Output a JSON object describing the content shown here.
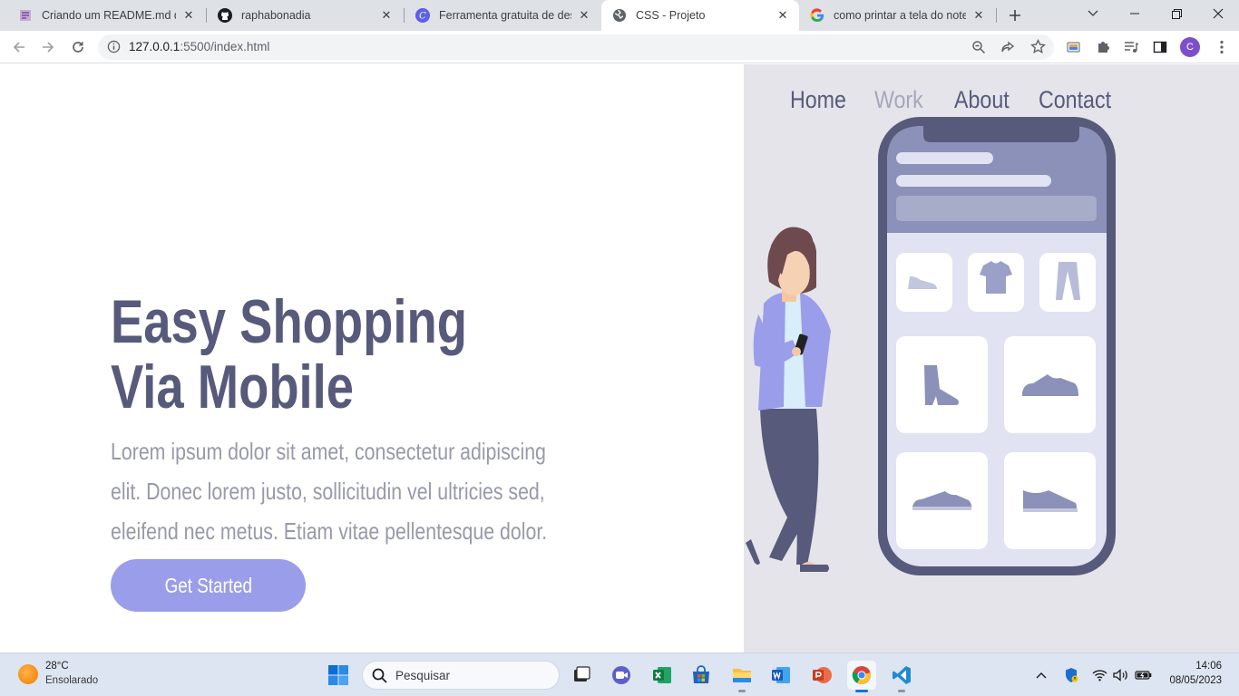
{
  "browser": {
    "tabs": [
      {
        "title": "Criando um README.md dos",
        "icon": "readme-icon",
        "active": false
      },
      {
        "title": "raphabonadia",
        "icon": "github-icon",
        "active": false
      },
      {
        "title": "Ferramenta gratuita de desig",
        "icon": "canva-icon",
        "active": false
      },
      {
        "title": "CSS - Projeto",
        "icon": "globe-icon",
        "active": true
      },
      {
        "title": "como printar a tela do noteb",
        "icon": "google-icon",
        "active": false
      }
    ],
    "url_host": "127.0.0.1",
    "url_path": ":5500/index.html",
    "profile_initial": "C"
  },
  "site": {
    "nav": [
      {
        "label": "Home",
        "active": false
      },
      {
        "label": "Work",
        "active": true
      },
      {
        "label": "About",
        "active": false
      },
      {
        "label": "Contact",
        "active": false
      }
    ],
    "hero": {
      "title_line1": "Easy Shopping",
      "title_line2": "Via Mobile",
      "text_line1": "Lorem ipsum dolor sit amet, consectetur adipiscing",
      "text_line2": "elit. Donec lorem justo, sollicitudin vel ultricies sed,",
      "text_line3": "eleifend nec metus. Etiam vitae pellentesque dolor.",
      "cta_label": "Get Started"
    },
    "colors": {
      "primary": "#575a7b",
      "muted_text": "#9899aa",
      "cta": "#9a9de9",
      "panel": "#e5e4ea"
    }
  },
  "taskbar": {
    "weather_temp": "28°C",
    "weather_desc": "Ensolarado",
    "search_placeholder": "Pesquisar",
    "apps": [
      "windows-start-icon",
      "task-view-icon",
      "teams-icon",
      "excel-icon",
      "store-icon",
      "file-explorer-icon",
      "word-icon",
      "powerpoint-icon",
      "chrome-icon",
      "vscode-icon"
    ],
    "time": "14:06",
    "date": "08/05/2023"
  }
}
